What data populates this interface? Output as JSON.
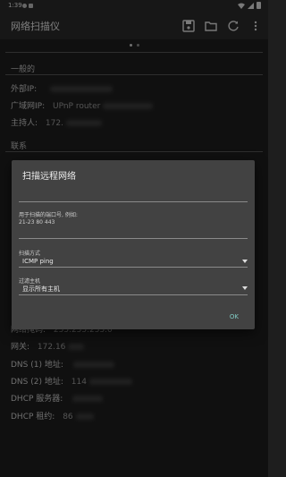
{
  "status": {
    "time": "1:39"
  },
  "appbar": {
    "title": "网络扫描仪",
    "actions": [
      "save-icon",
      "folder-icon",
      "refresh-icon",
      "more-vert-icon"
    ]
  },
  "sections": {
    "general": "一般的",
    "connection": "联系"
  },
  "rows": {
    "external_ip": "外部IP:",
    "wan_ip": "广域网IP:",
    "wan_ip_value": "UPnP router ",
    "host": "主持人:",
    "host_value": "172.",
    "subnet": "网络掩码:",
    "subnet_value": "255.255.255.0",
    "gateway": "网关:",
    "gateway_value": "172.16",
    "dns1": "DNS (1) 地址:",
    "dns2": "DNS (2) 地址:",
    "dns2_value": "114",
    "dhcp_server": "DHCP 服务器:",
    "dhcp_lease": "DHCP 租约:",
    "dhcp_lease_value": "86"
  },
  "dialog": {
    "title": "扫描远程网络",
    "ports_hint_line1": "用于扫描的端口号, 例如:",
    "ports_hint_line2": "21-23 80 443",
    "method_label": "扫描方式",
    "method_value": "ICMP ping",
    "filter_label": "过滤主机",
    "filter_value": "显示所有主机",
    "ok": "OK"
  }
}
